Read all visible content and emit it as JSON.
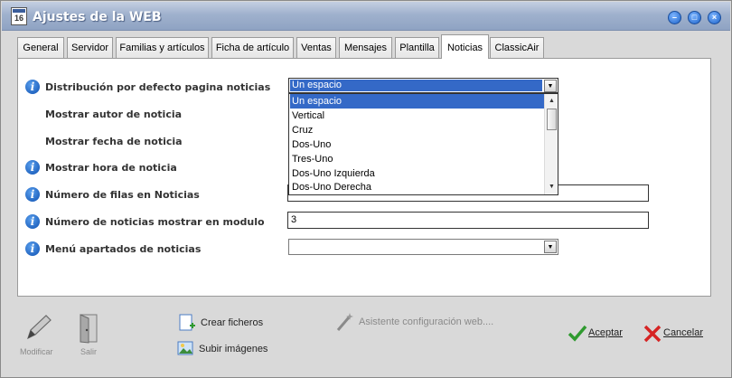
{
  "window": {
    "title": "Ajustes de la WEB",
    "icon_text": "16"
  },
  "tabs": [
    {
      "label": "General"
    },
    {
      "label": "Servidor"
    },
    {
      "label": "Familias y artículos"
    },
    {
      "label": "Ficha de artículo"
    },
    {
      "label": "Ventas"
    },
    {
      "label": "Mensajes"
    },
    {
      "label": "Plantilla"
    },
    {
      "label": "Noticias",
      "active": true
    },
    {
      "label": "ClassicAir"
    }
  ],
  "form": {
    "distribucion": {
      "label": "Distribución por defecto pagina noticias",
      "value": "Un espacio",
      "options": [
        "Un espacio",
        "Vertical",
        "Cruz",
        "Dos-Uno",
        "Tres-Uno",
        "Dos-Uno Izquierda",
        "Dos-Uno Derecha"
      ]
    },
    "autor": {
      "label": "Mostrar autor de noticia"
    },
    "fecha": {
      "label": "Mostrar fecha de noticia"
    },
    "hora": {
      "label": "Mostrar hora de noticia"
    },
    "filas": {
      "label": "Número de filas en Noticias",
      "value": ""
    },
    "mostrar_modulo": {
      "label": "Número de noticias mostrar en modulo",
      "value": "3"
    },
    "apartados": {
      "label": "Menú apartados de noticias",
      "value": ""
    }
  },
  "toolbar": {
    "modificar": "Modificar",
    "salir": "Salir",
    "crear_ficheros": "Crear ficheros",
    "subir_imagenes": "Subir imágenes",
    "asistente": "Asistente configuración web....",
    "aceptar": "Aceptar",
    "cancelar": "Cancelar"
  },
  "icons": {
    "info": "info-icon",
    "pencil": "pencil-icon",
    "door": "door-exit-icon",
    "new_file": "new-file-icon",
    "image_upload": "image-upload-icon",
    "wand": "magic-wand-icon",
    "check": "checkmark-icon",
    "cross": "cross-icon"
  },
  "colors": {
    "selection": "#3469c7",
    "titlebar": "#9fb1cd",
    "accept": "#2f9a2f",
    "cancel": "#d62424"
  }
}
